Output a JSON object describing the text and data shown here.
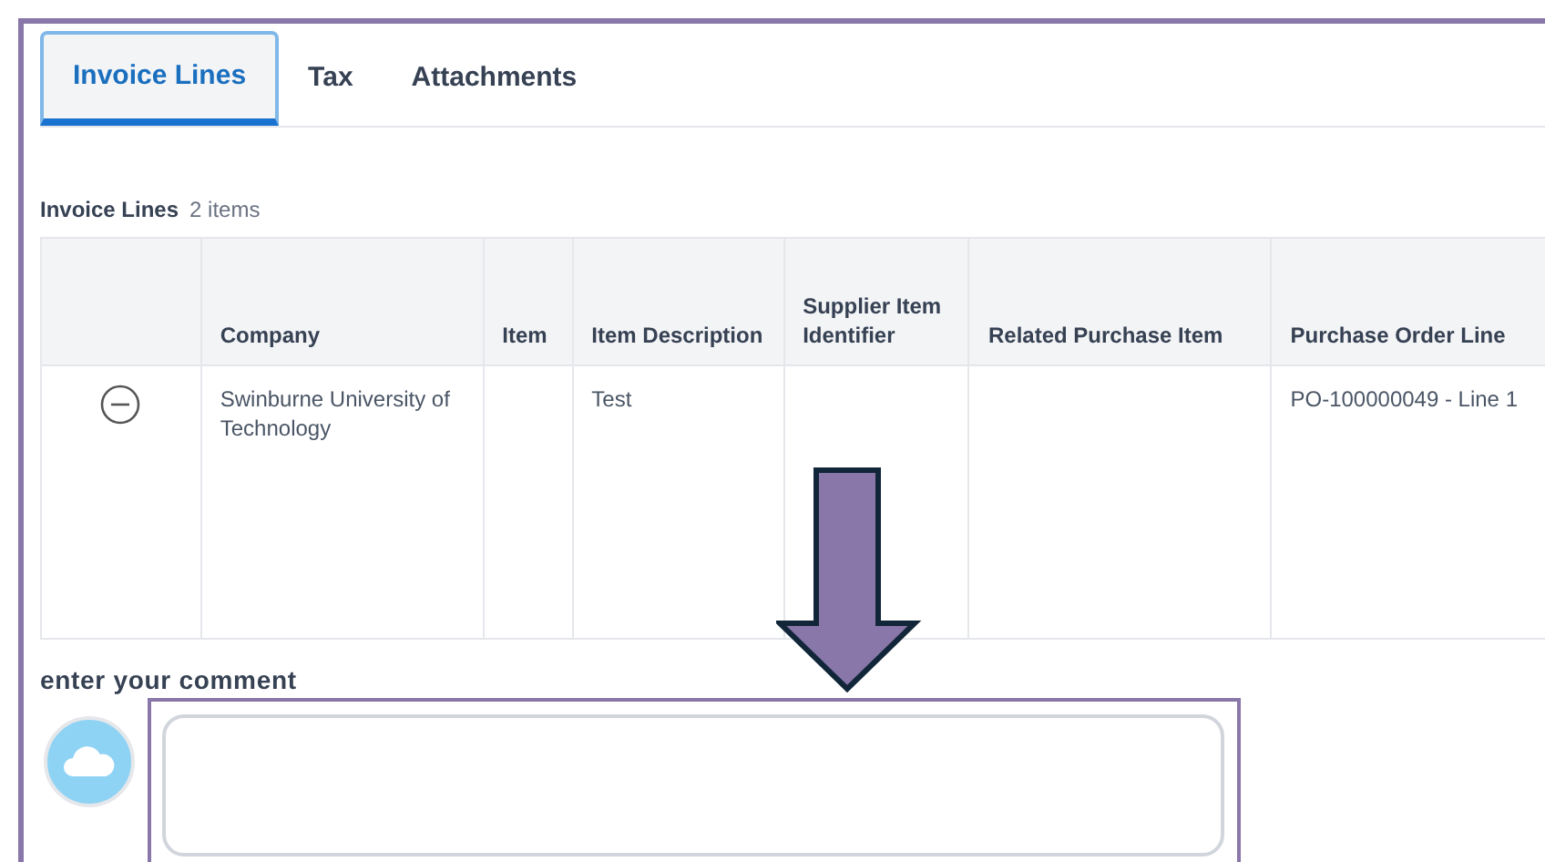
{
  "tabs": [
    {
      "label": "Invoice Lines",
      "selected": true
    },
    {
      "label": "Tax",
      "selected": false
    },
    {
      "label": "Attachments",
      "selected": false
    }
  ],
  "section": {
    "title": "Invoice Lines",
    "count": "2 items"
  },
  "table": {
    "columns": [
      "",
      "Company",
      "Item",
      "Item Description",
      "Supplier Item Identifier",
      "Related Purchase Item",
      "Purchase Order Line"
    ],
    "rows": [
      {
        "cells": [
          "",
          "Swinburne University of Technology",
          "",
          "Test",
          "",
          "",
          "PO-100000049 - Line 1"
        ]
      }
    ]
  },
  "comment": {
    "label": "enter your comment"
  }
}
